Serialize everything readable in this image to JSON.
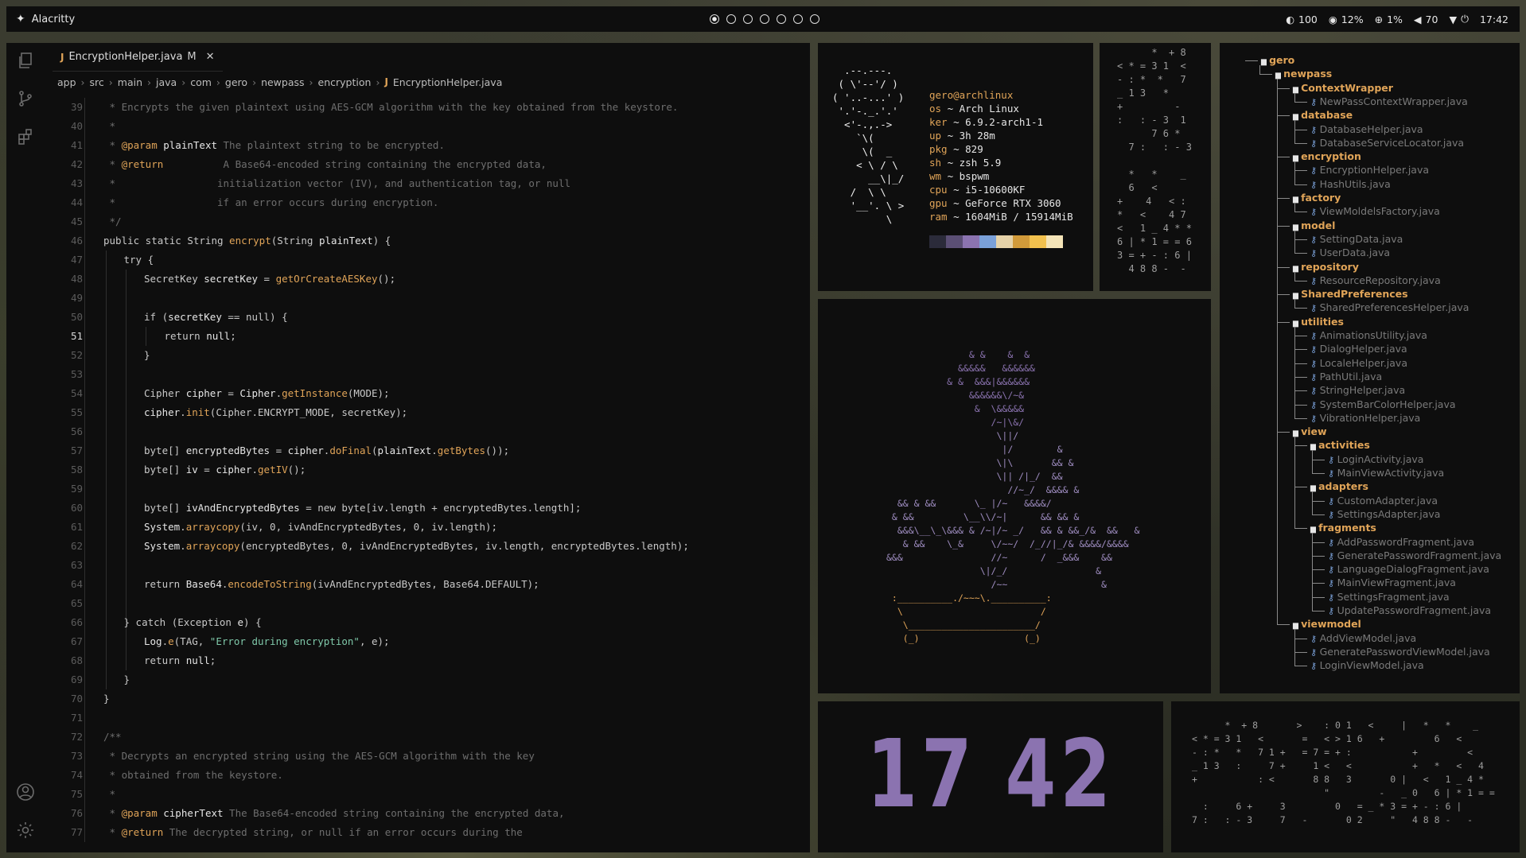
{
  "topbar": {
    "app": "Alacritty",
    "workspaces": 7,
    "active_workspace": 1,
    "brightness": "100",
    "cpu": "12%",
    "net": "1%",
    "volume": "70",
    "time": "17:42"
  },
  "editor": {
    "tab": {
      "name": "EncryptionHelper.java",
      "status": "M"
    },
    "breadcrumbs": [
      "app",
      "src",
      "main",
      "java",
      "com",
      "gero",
      "newpass",
      "encryption",
      "EncryptionHelper.java"
    ],
    "current_line": 51,
    "lines": [
      {
        "n": 39,
        "i": 0,
        "t": [
          [
            "cm",
            " * Encrypts the given plaintext using AES-GCM algorithm with the key obtained from the keystore."
          ]
        ]
      },
      {
        "n": 40,
        "i": 0,
        "t": [
          [
            "cm",
            " *"
          ]
        ]
      },
      {
        "n": 41,
        "i": 0,
        "t": [
          [
            "cm",
            " * "
          ],
          [
            "tag",
            "@param"
          ],
          [
            "pm",
            " plainText"
          ],
          [
            "cm",
            " The plaintext string to be encrypted."
          ]
        ]
      },
      {
        "n": 42,
        "i": 0,
        "t": [
          [
            "cm",
            " * "
          ],
          [
            "tag",
            "@return"
          ],
          [
            "cm",
            "          A Base64-encoded string containing the encrypted data,"
          ]
        ]
      },
      {
        "n": 43,
        "i": 0,
        "t": [
          [
            "cm",
            " *                 initialization vector (IV), and authentication tag, or null"
          ]
        ]
      },
      {
        "n": 44,
        "i": 0,
        "t": [
          [
            "cm",
            " *                 if an error occurs during encryption."
          ]
        ]
      },
      {
        "n": 45,
        "i": 0,
        "t": [
          [
            "cm",
            " */"
          ]
        ]
      },
      {
        "n": 46,
        "i": 0,
        "t": [
          [
            "kw",
            "public static String "
          ],
          [
            "fn",
            "encrypt"
          ],
          [
            "kw",
            "(String "
          ],
          [
            "pm",
            "plainText"
          ],
          [
            "kw",
            ") {"
          ]
        ]
      },
      {
        "n": 47,
        "i": 1,
        "t": [
          [
            "kw",
            "try {"
          ]
        ]
      },
      {
        "n": 48,
        "i": 2,
        "t": [
          [
            "kw",
            "SecretKey "
          ],
          [
            "pm",
            "secretKey"
          ],
          [
            "kw",
            " = "
          ],
          [
            "fn",
            "getOrCreateAESKey"
          ],
          [
            "kw",
            "();"
          ]
        ]
      },
      {
        "n": 49,
        "i": 0,
        "t": []
      },
      {
        "n": 50,
        "i": 2,
        "t": [
          [
            "kw",
            "if ("
          ],
          [
            "pm",
            "secretKey"
          ],
          [
            "kw",
            " == null) {"
          ]
        ]
      },
      {
        "n": 51,
        "i": 3,
        "t": [
          [
            "kw",
            "return "
          ],
          [
            "pm",
            "null"
          ],
          [
            "kw",
            ";"
          ]
        ]
      },
      {
        "n": 52,
        "i": 2,
        "t": [
          [
            "kw",
            "}"
          ]
        ]
      },
      {
        "n": 53,
        "i": 0,
        "t": []
      },
      {
        "n": 54,
        "i": 2,
        "t": [
          [
            "kw",
            "Cipher "
          ],
          [
            "pm",
            "cipher"
          ],
          [
            "kw",
            " = "
          ],
          [
            "pm",
            "Cipher"
          ],
          [
            "kw",
            "."
          ],
          [
            "fn",
            "getInstance"
          ],
          [
            "kw",
            "(MODE);"
          ]
        ]
      },
      {
        "n": 55,
        "i": 2,
        "t": [
          [
            "pm",
            "cipher"
          ],
          [
            "kw",
            "."
          ],
          [
            "fn",
            "init"
          ],
          [
            "kw",
            "(Cipher.ENCRYPT_MODE, secretKey);"
          ]
        ]
      },
      {
        "n": 56,
        "i": 0,
        "t": []
      },
      {
        "n": 57,
        "i": 2,
        "t": [
          [
            "kw",
            "byte[] "
          ],
          [
            "pm",
            "encryptedBytes"
          ],
          [
            "kw",
            " = "
          ],
          [
            "pm",
            "cipher"
          ],
          [
            "kw",
            "."
          ],
          [
            "fn",
            "doFinal"
          ],
          [
            "kw",
            "("
          ],
          [
            "pm",
            "plainText"
          ],
          [
            "kw",
            "."
          ],
          [
            "fn",
            "getBytes"
          ],
          [
            "kw",
            "());"
          ]
        ]
      },
      {
        "n": 58,
        "i": 2,
        "t": [
          [
            "kw",
            "byte[] "
          ],
          [
            "pm",
            "iv"
          ],
          [
            "kw",
            " = "
          ],
          [
            "pm",
            "cipher"
          ],
          [
            "kw",
            "."
          ],
          [
            "fn",
            "getIV"
          ],
          [
            "kw",
            "();"
          ]
        ]
      },
      {
        "n": 59,
        "i": 0,
        "t": []
      },
      {
        "n": 60,
        "i": 2,
        "t": [
          [
            "kw",
            "byte[] "
          ],
          [
            "pm",
            "ivAndEncryptedBytes"
          ],
          [
            "kw",
            " = new byte[iv.length + encryptedBytes.length];"
          ]
        ]
      },
      {
        "n": 61,
        "i": 2,
        "t": [
          [
            "pm",
            "System"
          ],
          [
            "kw",
            "."
          ],
          [
            "fn",
            "arraycopy"
          ],
          [
            "kw",
            "(iv, 0, ivAndEncryptedBytes, 0, iv.length);"
          ]
        ]
      },
      {
        "n": 62,
        "i": 2,
        "t": [
          [
            "pm",
            "System"
          ],
          [
            "kw",
            "."
          ],
          [
            "fn",
            "arraycopy"
          ],
          [
            "kw",
            "(encryptedBytes, 0, ivAndEncryptedBytes, iv.length, encryptedBytes.length);"
          ]
        ]
      },
      {
        "n": 63,
        "i": 0,
        "t": []
      },
      {
        "n": 64,
        "i": 2,
        "t": [
          [
            "kw",
            "return "
          ],
          [
            "pm",
            "Base64"
          ],
          [
            "kw",
            "."
          ],
          [
            "fn",
            "encodeToString"
          ],
          [
            "kw",
            "(ivAndEncryptedBytes, Base64.DEFAULT);"
          ]
        ]
      },
      {
        "n": 65,
        "i": 0,
        "t": []
      },
      {
        "n": 66,
        "i": 1,
        "t": [
          [
            "kw",
            "} catch (Exception "
          ],
          [
            "pm",
            "e"
          ],
          [
            "kw",
            ") {"
          ]
        ]
      },
      {
        "n": 67,
        "i": 2,
        "t": [
          [
            "pm",
            "Log"
          ],
          [
            "kw",
            "."
          ],
          [
            "fn",
            "e"
          ],
          [
            "kw",
            "(TAG, "
          ],
          [
            "st",
            "\"Error during encryption\""
          ],
          [
            "kw",
            ", e);"
          ]
        ]
      },
      {
        "n": 68,
        "i": 2,
        "t": [
          [
            "kw",
            "return "
          ],
          [
            "pm",
            "null"
          ],
          [
            "kw",
            ";"
          ]
        ]
      },
      {
        "n": 69,
        "i": 1,
        "t": [
          [
            "kw",
            "}"
          ]
        ]
      },
      {
        "n": 70,
        "i": 0,
        "t": [
          [
            "kw",
            "}"
          ]
        ]
      },
      {
        "n": 71,
        "i": 0,
        "t": []
      },
      {
        "n": 72,
        "i": 0,
        "t": [
          [
            "cm",
            "/**"
          ]
        ]
      },
      {
        "n": 73,
        "i": 0,
        "t": [
          [
            "cm",
            " * Decrypts an encrypted string using the AES-GCM algorithm with the key"
          ]
        ]
      },
      {
        "n": 74,
        "i": 0,
        "t": [
          [
            "cm",
            " * obtained from the keystore."
          ]
        ]
      },
      {
        "n": 75,
        "i": 0,
        "t": [
          [
            "cm",
            " *"
          ]
        ]
      },
      {
        "n": 76,
        "i": 0,
        "t": [
          [
            "cm",
            " * "
          ],
          [
            "tag",
            "@param"
          ],
          [
            "pm",
            " cipherText"
          ],
          [
            "cm",
            " The Base64-encoded string containing the encrypted data,"
          ]
        ]
      },
      {
        "n": 77,
        "i": 0,
        "t": [
          [
            "cm",
            " * "
          ],
          [
            "tag",
            "@return"
          ],
          [
            "cm",
            " The decrypted string, or null if an error occurs during the"
          ]
        ]
      }
    ]
  },
  "fetch": {
    "logo": "  .--.---.\n ( \\'--'/ )\n( '..-...' )\n '.'-._.'.'\n  <'-.,.->\n    `\\(\n     \\(  _\n    < \\ / \\\n      __\\|_/\n   /  \\ \\\n   '__'. \\ >\n         \\",
    "user": "gero@archlinux",
    "rows": [
      [
        "os",
        "Arch Linux"
      ],
      [
        "ker",
        "6.9.2-arch1-1"
      ],
      [
        "up",
        "3h 28m"
      ],
      [
        "pkg",
        "829"
      ],
      [
        "sh",
        "zsh 5.9"
      ],
      [
        "wm",
        "bspwm"
      ],
      [
        "cpu",
        "i5-10600KF"
      ],
      [
        "gpu",
        "GeForce RTX 3060"
      ],
      [
        "ram",
        "1604MiB / 15914MiB"
      ]
    ],
    "palette": [
      "#2b2b3a",
      "#5b4f75",
      "#8b73b0",
      "#7aa0d8",
      "#e5d2a8",
      "#d19a3a",
      "#f2c14e",
      "#f4e4b8"
    ]
  },
  "matrix_a": "      *  + 8\n< * = 3 1  <\n- : *  *   7\n_ 1 3   *\n+         -\n:   : - 3  1\n      7 6 *\n  7 :   : - 3\n\n  *   *    _\n  6   <\n+    4   < :\n*   <    4 7\n<   1 _ 4 * *\n6 | * 1 = = 6\n3 = + - : 6 |\n  4 8 8 -  -",
  "matrix_b": "      *  + 8       >    : 0 1   <     |   *   *    _\n< * = 3 1   <       =   < > 1 6   +         6   <\n- : *   *   7 1 +   = 7 = + :           +         <\n_ 1 3   :     7 +     1 <   <           +   *   <   4\n+           : <       8 8   3       0 |   <   1 _ 4 *\n                        \"         -   _ 0   6 | * 1 = =\n  :     6 +     3         0   = _ * 3 = + - : 6 |\n7 :   : - 3     7   -       0 2     \"   4 8 8 -   -",
  "plant": "               & &    &  &\n             &&&&&   &&&&&&\n           & &  &&&|&&&&&&\n               &&&&&&\\/~&\n                &  \\&&&&&\n                   /~|\\&/\n                    \\||/\n                     |/        &\n                    \\|\\       && &\n                    \\|| /|_/  &&\n                      //~_/  &&&& &\n  && & &&       \\_ |/~   &&&&/\n & &&         \\__\\\\/~|      && && &\n  &&&\\__\\_\\&&& & /~|/~ _/   && & &&_/&  &&   &\n   & &&    \\_&     \\/~~/  /_//|_/& &&&&/&&&&\n&&&                //~      /  _&&&    &&\n                 \\|/_/                &\n                   /~~                 &\n :__________./~~~\\.__________:\n  \\                         /\n   \\_______________________/\n   (_)                   (_)",
  "clock": "17 42",
  "tree": {
    "rows": [
      {
        "d": 0,
        "type": "dir",
        "name": "gero"
      },
      {
        "d": 1,
        "type": "dir",
        "name": "newpass"
      },
      {
        "d": 2,
        "type": "dir",
        "name": "ContextWrapper"
      },
      {
        "d": 3,
        "type": "file",
        "name": "NewPassContextWrapper.java"
      },
      {
        "d": 2,
        "type": "dir",
        "name": "database"
      },
      {
        "d": 3,
        "type": "file",
        "name": "DatabaseHelper.java"
      },
      {
        "d": 3,
        "type": "file",
        "name": "DatabaseServiceLocator.java"
      },
      {
        "d": 2,
        "type": "dir",
        "name": "encryption"
      },
      {
        "d": 3,
        "type": "file",
        "name": "EncryptionHelper.java"
      },
      {
        "d": 3,
        "type": "file",
        "name": "HashUtils.java"
      },
      {
        "d": 2,
        "type": "dir",
        "name": "factory"
      },
      {
        "d": 3,
        "type": "file",
        "name": "ViewMoldelsFactory.java"
      },
      {
        "d": 2,
        "type": "dir",
        "name": "model"
      },
      {
        "d": 3,
        "type": "file",
        "name": "SettingData.java"
      },
      {
        "d": 3,
        "type": "file",
        "name": "UserData.java"
      },
      {
        "d": 2,
        "type": "dir",
        "name": "repository"
      },
      {
        "d": 3,
        "type": "file",
        "name": "ResourceRepository.java"
      },
      {
        "d": 2,
        "type": "dir",
        "name": "SharedPreferences"
      },
      {
        "d": 3,
        "type": "file",
        "name": "SharedPreferencesHelper.java"
      },
      {
        "d": 2,
        "type": "dir",
        "name": "utilities"
      },
      {
        "d": 3,
        "type": "file",
        "name": "AnimationsUtility.java"
      },
      {
        "d": 3,
        "type": "file",
        "name": "DialogHelper.java"
      },
      {
        "d": 3,
        "type": "file",
        "name": "LocaleHelper.java"
      },
      {
        "d": 3,
        "type": "file",
        "name": "PathUtil.java"
      },
      {
        "d": 3,
        "type": "file",
        "name": "StringHelper.java"
      },
      {
        "d": 3,
        "type": "file",
        "name": "SystemBarColorHelper.java"
      },
      {
        "d": 3,
        "type": "file",
        "name": "VibrationHelper.java"
      },
      {
        "d": 2,
        "type": "dir",
        "name": "view"
      },
      {
        "d": 3,
        "type": "dir",
        "name": "activities"
      },
      {
        "d": 4,
        "type": "file",
        "name": "LoginActivity.java"
      },
      {
        "d": 4,
        "type": "file",
        "name": "MainViewActivity.java"
      },
      {
        "d": 3,
        "type": "dir",
        "name": "adapters"
      },
      {
        "d": 4,
        "type": "file",
        "name": "CustomAdapter.java"
      },
      {
        "d": 4,
        "type": "file",
        "name": "SettingsAdapter.java"
      },
      {
        "d": 3,
        "type": "dir",
        "name": "fragments"
      },
      {
        "d": 4,
        "type": "file",
        "name": "AddPasswordFragment.java"
      },
      {
        "d": 4,
        "type": "file",
        "name": "GeneratePasswordFragment.java"
      },
      {
        "d": 4,
        "type": "file",
        "name": "LanguageDialogFragment.java"
      },
      {
        "d": 4,
        "type": "file",
        "name": "MainViewFragment.java"
      },
      {
        "d": 4,
        "type": "file",
        "name": "SettingsFragment.java"
      },
      {
        "d": 4,
        "type": "file",
        "name": "UpdatePasswordFragment.java"
      },
      {
        "d": 2,
        "type": "dir",
        "name": "viewmodel"
      },
      {
        "d": 3,
        "type": "file",
        "name": "AddViewModel.java"
      },
      {
        "d": 3,
        "type": "file",
        "name": "GeneratePasswordViewModel.java"
      },
      {
        "d": 3,
        "type": "file",
        "name": "LoginViewModel.java"
      }
    ]
  }
}
